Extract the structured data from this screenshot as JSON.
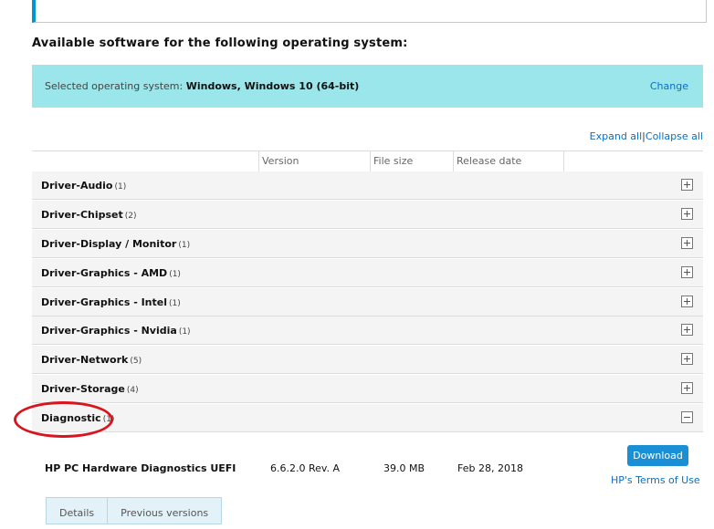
{
  "heading": "Available software for the following operating system:",
  "os_bar": {
    "label": "Selected operating system:",
    "value": "Windows, Windows 10 (64-bit)",
    "change_label": "Change"
  },
  "expand": {
    "expand_all": "Expand all",
    "separator": "|",
    "collapse_all": "Collapse all"
  },
  "columns": {
    "version": "Version",
    "file_size": "File size",
    "release_date": "Release date"
  },
  "categories": [
    {
      "name": "Driver-Audio",
      "count": "(1)",
      "expanded": false
    },
    {
      "name": "Driver-Chipset",
      "count": "(2)",
      "expanded": false
    },
    {
      "name": "Driver-Display / Monitor",
      "count": "(1)",
      "expanded": false
    },
    {
      "name": "Driver-Graphics - AMD",
      "count": "(1)",
      "expanded": false
    },
    {
      "name": "Driver-Graphics - Intel",
      "count": "(1)",
      "expanded": false
    },
    {
      "name": "Driver-Graphics - Nvidia",
      "count": "(1)",
      "expanded": false
    },
    {
      "name": "Driver-Network",
      "count": "(5)",
      "expanded": false
    },
    {
      "name": "Driver-Storage",
      "count": "(4)",
      "expanded": false
    },
    {
      "name": "Diagnostic",
      "count": "(1)",
      "expanded": true
    }
  ],
  "software": {
    "name": "HP PC Hardware Diagnostics UEFI",
    "version": "6.6.2.0 Rev. A",
    "file_size": "39.0 MB",
    "release_date": "Feb 28, 2018",
    "download_label": "Download",
    "terms_label": "HP's Terms of Use"
  },
  "tabs": [
    "Details",
    "Previous versions"
  ],
  "colors": {
    "os_bar": "#9ae6ea",
    "link": "#0b6fc4",
    "download_button": "#1a8fd6",
    "highlight_ellipse": "#d9141e"
  }
}
